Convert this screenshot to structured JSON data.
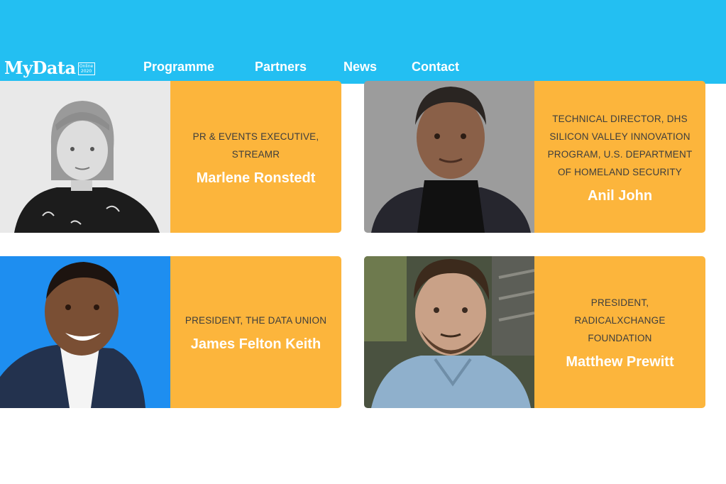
{
  "header": {
    "logo_text": "MyData",
    "logo_badge_top": "Online",
    "logo_badge_bottom": "2020",
    "nav": [
      "Programme",
      "Partners",
      "News",
      "Contact"
    ]
  },
  "colors": {
    "header_bg": "#23bff2",
    "card_bg": "#fcb53c",
    "photo_blue_bg": "#1e8ef0"
  },
  "speakers": [
    {
      "role": "PR & EVENTS EXECUTIVE, STREAMR",
      "name": "Marlene Ronstedt",
      "photo": "portrait-photo"
    },
    {
      "role": "TECHNICAL DIRECTOR, DHS SILICON VALLEY INNOVATION PROGRAM, U.S. DEPARTMENT OF HOMELAND SECURITY",
      "name": "Anil John",
      "photo": "portrait-photo"
    },
    {
      "role": "PRESIDENT, THE DATA UNION",
      "name": "James Felton Keith",
      "photo": "portrait-photo"
    },
    {
      "role": "PRESIDENT, RADICALXCHANGE FOUNDATION",
      "name": "Matthew Prewitt",
      "photo": "portrait-photo"
    }
  ]
}
